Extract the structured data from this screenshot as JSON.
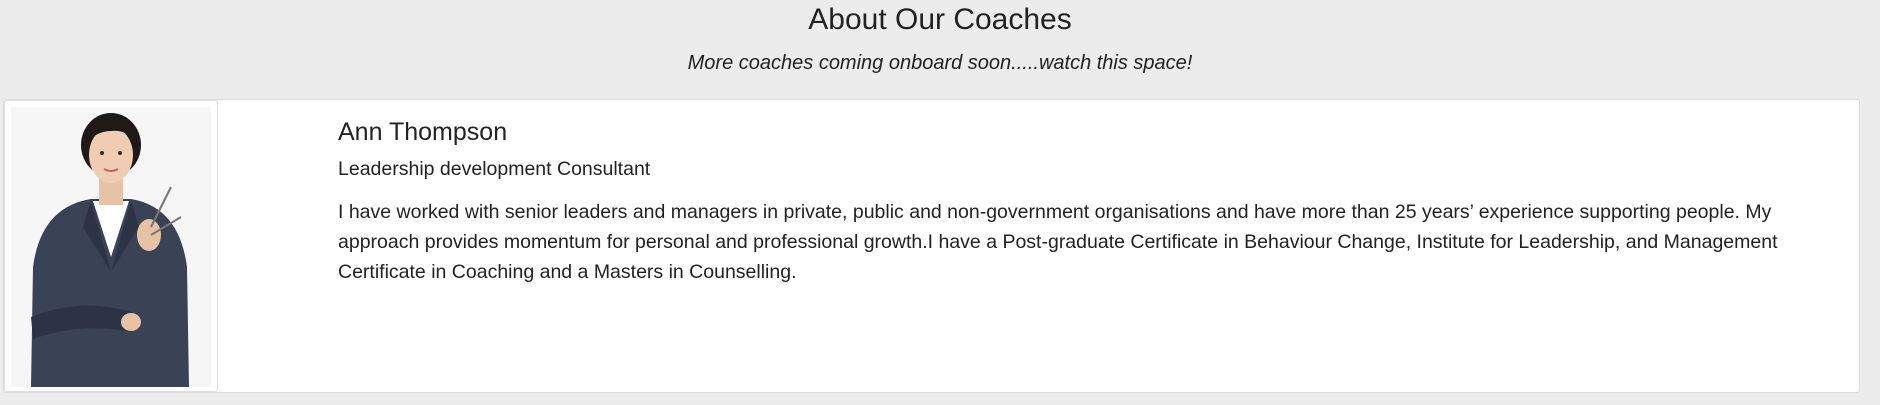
{
  "header": {
    "title": "About Our Coaches",
    "subtitle": "More coaches coming onboard soon.....watch this space!"
  },
  "coaches": [
    {
      "name": "Ann Thompson",
      "role": "Leadership development Consultant",
      "bio": "I have worked with senior leaders and managers in private, public and non-government organisations and have more than 25 years’ experience supporting people. My approach provides momentum for personal and professional growth.I have a Post-graduate Certificate in Behaviour Change, Institute for Leadership, and Management Certificate in Coaching and a Masters in Counselling.",
      "photo_icon": "coach-portrait"
    }
  ]
}
